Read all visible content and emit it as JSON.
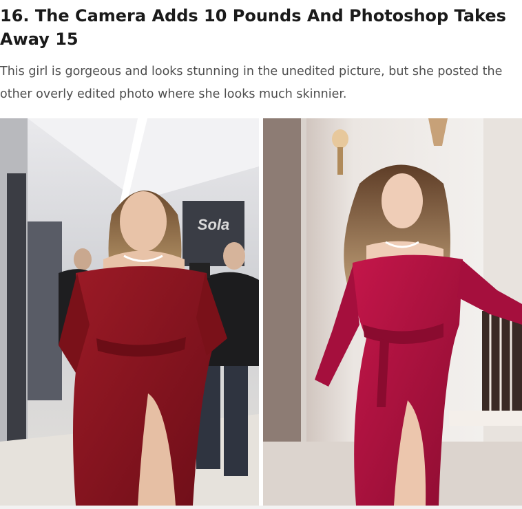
{
  "article": {
    "heading": "16. The Camera Adds 10 Pounds And Photoshop Takes Away 15",
    "description": "This girl is gorgeous and looks stunning in the unedited picture, but she posted the other overly edited photo where she looks much skinnier."
  },
  "photos": {
    "left": {
      "sign_text": "Sola"
    },
    "right": {}
  },
  "colors": {
    "dress_left": "#8e1420",
    "dress_right": "#b0123e",
    "heading": "#1a1a1a",
    "body_text": "#4d4d4d"
  }
}
